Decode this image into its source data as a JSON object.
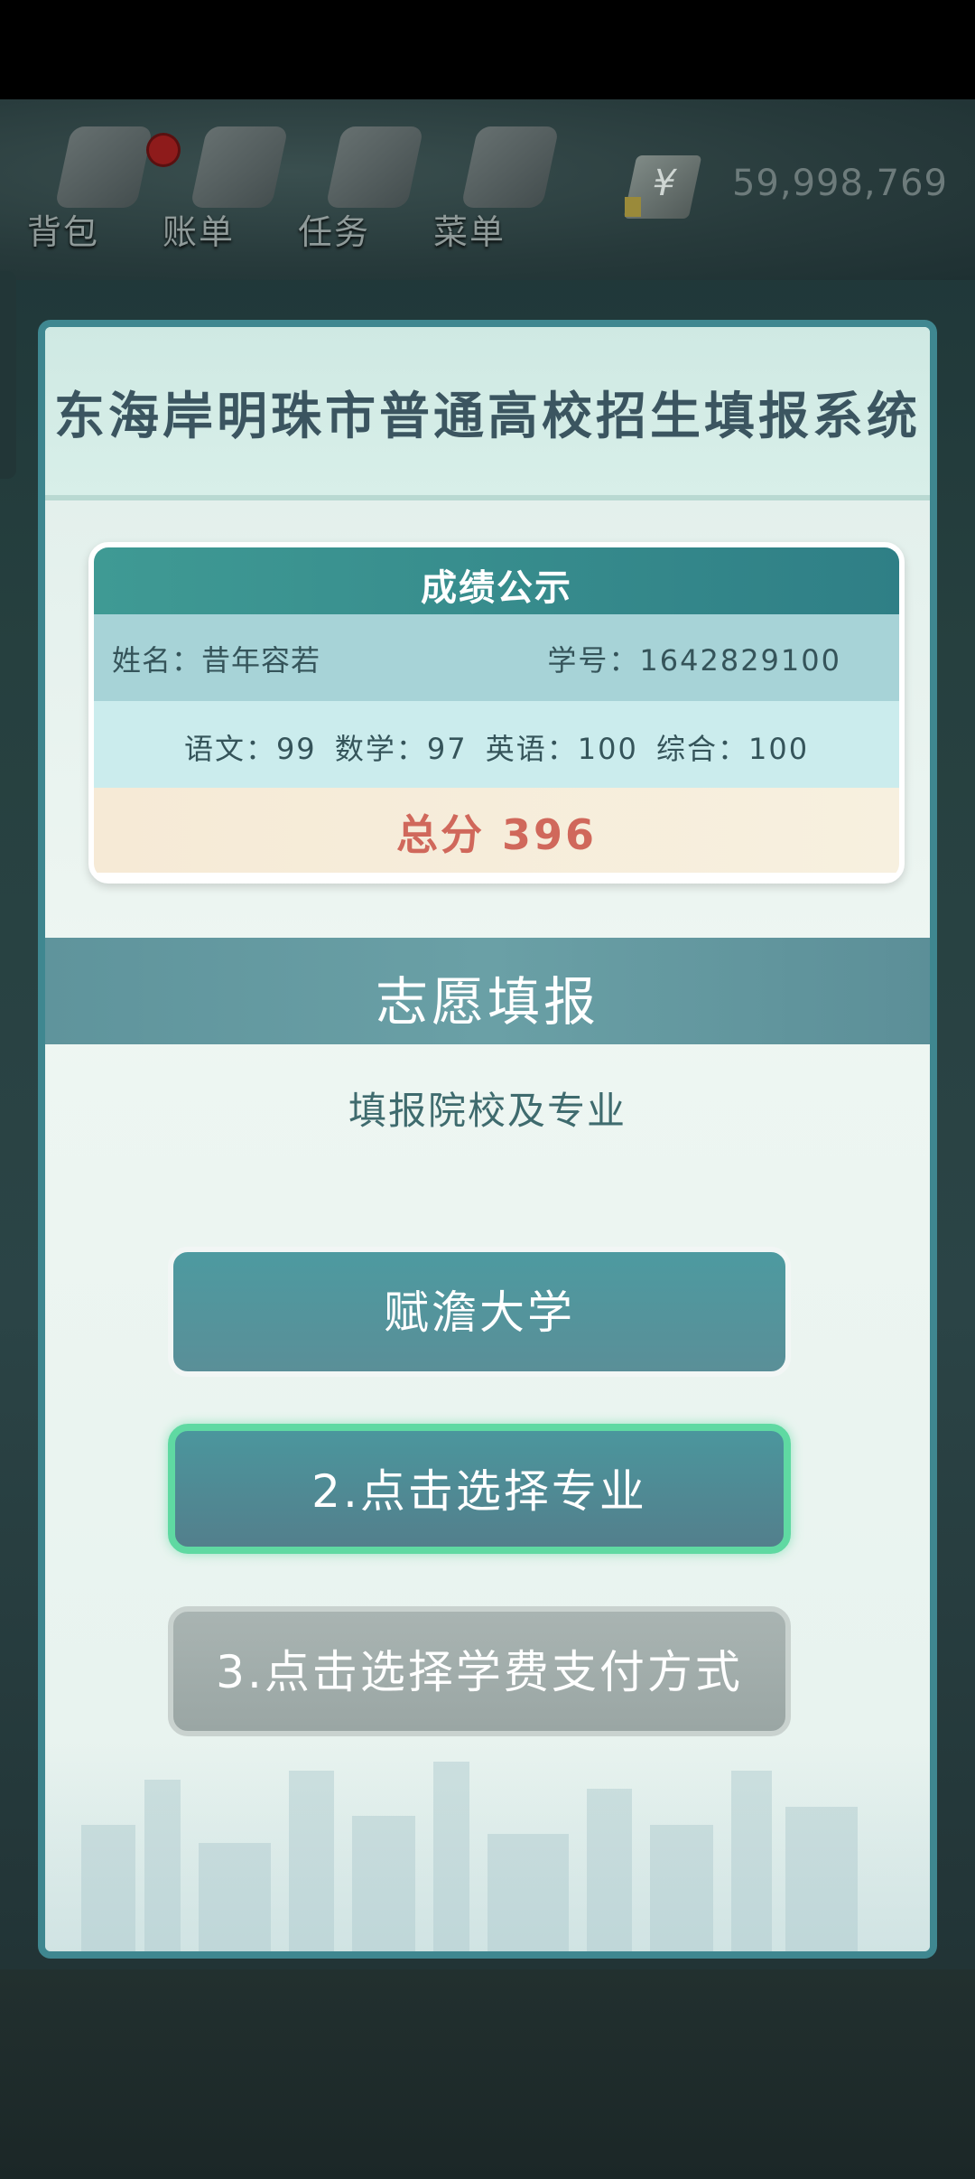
{
  "hud": {
    "items": [
      {
        "label": "背包",
        "icon": "backpack-icon",
        "badge": true
      },
      {
        "label": "账单",
        "icon": "bill-icon"
      },
      {
        "label": "任务",
        "icon": "task-icon"
      },
      {
        "label": "菜单",
        "icon": "menu-icon"
      }
    ],
    "currency_symbol": "¥",
    "money": "59,998,769"
  },
  "panel": {
    "title": "东海岸明珠市普通高校招生填报系统"
  },
  "scores": {
    "header": "成绩公示",
    "name_line": "姓名：昔年容若",
    "id_line": "学号：1642829100",
    "subjects_line": "语文：99  数学：97  英语：100  综合：100",
    "total_line": "总分 396"
  },
  "volunteer": {
    "heading": "志愿填报",
    "subheading": "填报院校及专业",
    "university_button": "赋澹大学",
    "major_button": "2.点击选择专业",
    "fee_button": "3.点击选择学费支付方式"
  },
  "colors": {
    "panel_border": "#3f8790",
    "highlight": "#5fd9a2",
    "total": "#d0685b"
  }
}
